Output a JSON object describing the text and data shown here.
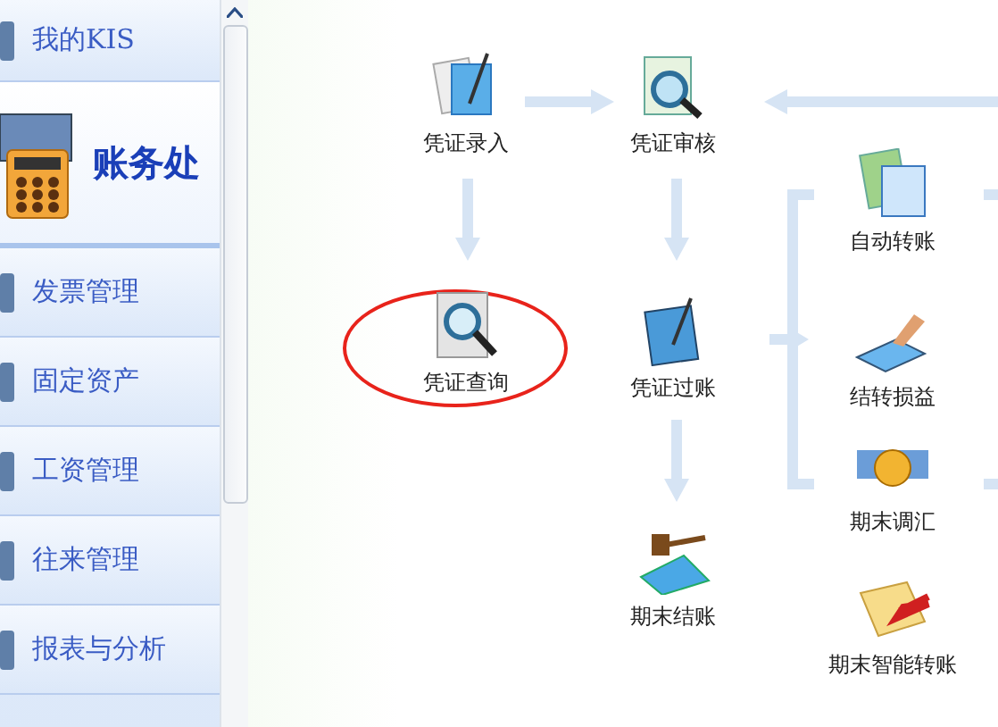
{
  "sidebar": {
    "items": [
      {
        "label": "我的KIS",
        "selected": false
      },
      {
        "label": "账务处",
        "selected": true
      },
      {
        "label": "发票管理",
        "selected": false
      },
      {
        "label": "固定资产",
        "selected": false
      },
      {
        "label": "工资管理",
        "selected": false
      },
      {
        "label": "往来管理",
        "selected": false
      },
      {
        "label": "报表与分析",
        "selected": false
      }
    ]
  },
  "flow": {
    "nodes": [
      {
        "label": "凭证录入",
        "highlighted": false
      },
      {
        "label": "凭证审核",
        "highlighted": false
      },
      {
        "label": "凭证查询",
        "highlighted": true
      },
      {
        "label": "凭证过账",
        "highlighted": false
      },
      {
        "label": "期末结账",
        "highlighted": false
      },
      {
        "label": "自动转账",
        "highlighted": false
      },
      {
        "label": "结转损益",
        "highlighted": false
      },
      {
        "label": "期末调汇",
        "highlighted": false
      },
      {
        "label": "期末智能转账",
        "highlighted": false
      }
    ]
  }
}
